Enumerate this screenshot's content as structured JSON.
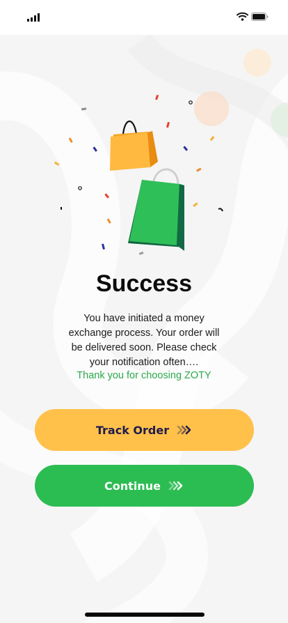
{
  "status_bar": {
    "signal_icon": "cellular-signal-icon",
    "wifi_icon": "wifi-icon",
    "battery_icon": "battery-icon"
  },
  "illustration": {
    "icons": [
      "shopping-bag-orange-icon",
      "shopping-bag-green-icon",
      "confetti-icon"
    ]
  },
  "success": {
    "title": "Success",
    "message": "You have initiated a money exchange process. Your order will be delivered soon. Please check your notification often….",
    "thanks": "Thank you for choosing ZOTY"
  },
  "buttons": {
    "track_order": "Track Order",
    "continue": "Continue",
    "arrow_icon": "double-chevron-right-icon"
  },
  "colors": {
    "accent_yellow": "#ffc14a",
    "accent_green": "#2cbd52",
    "track_text": "#1e1b4d",
    "thanks_text": "#2aa84a"
  }
}
